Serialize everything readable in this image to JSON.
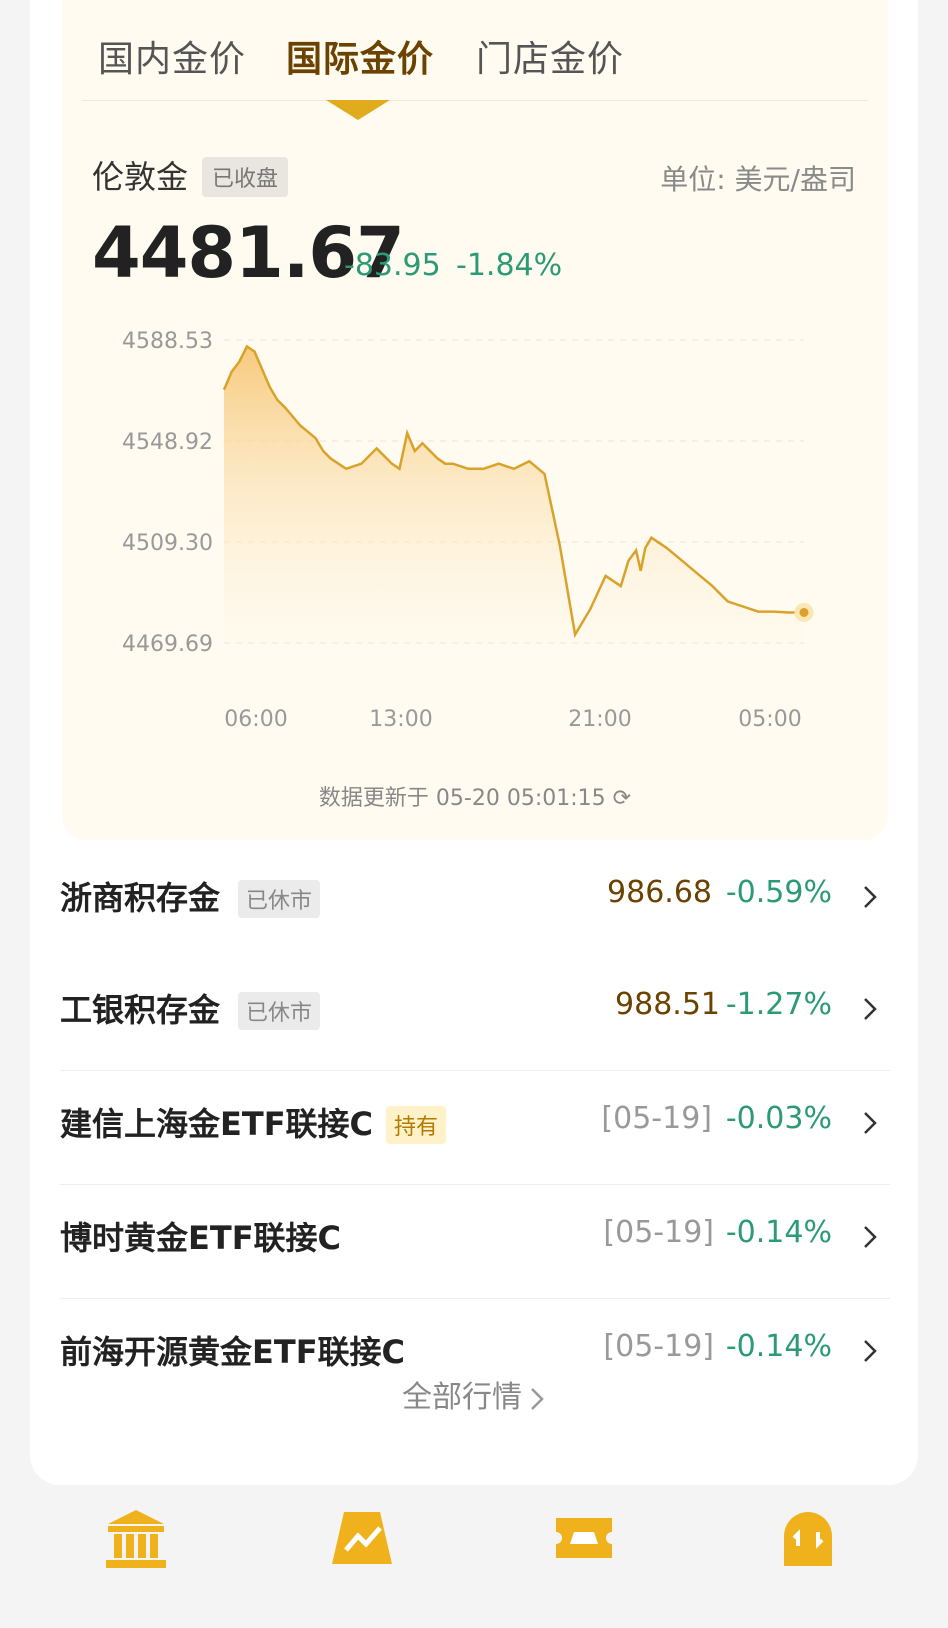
{
  "tabs": [
    {
      "label": "国内金价"
    },
    {
      "label": "国际金价"
    },
    {
      "label": "门店金价"
    }
  ],
  "active_tab": 1,
  "instrument": {
    "name": "伦敦金",
    "status": "已收盘",
    "unit": "单位: 美元/盎司",
    "price": "4481.67",
    "change": "-83.95",
    "change_pct": "-1.84%"
  },
  "chart_data": {
    "type": "area",
    "y_ticks": [
      "4588.53",
      "4548.92",
      "4509.30",
      "4469.69"
    ],
    "x_ticks": [
      "06:00",
      "13:00",
      "21:00",
      "05:00"
    ],
    "ylim": [
      4469.69,
      4588.53
    ],
    "x": [
      0,
      0.5,
      1,
      1.5,
      2,
      3,
      3.5,
      4,
      5,
      6,
      6.5,
      7,
      8,
      9,
      10,
      11,
      11.5,
      12,
      12.5,
      13,
      13.5,
      14,
      14.5,
      15,
      16,
      17,
      18,
      19,
      20,
      21,
      22,
      23,
      24,
      25,
      26,
      26.5,
      27,
      27.3,
      27.6,
      28,
      28.5,
      29,
      30,
      31,
      32,
      33,
      34,
      35,
      36,
      37,
      38
    ],
    "values": [
      4569,
      4576,
      4580,
      4586,
      4584,
      4570,
      4565,
      4562,
      4555,
      4550,
      4545,
      4542,
      4538,
      4540,
      4546,
      4540,
      4538,
      4552,
      4545,
      4548,
      4545,
      4542,
      4540,
      4540,
      4538,
      4538,
      4540,
      4538,
      4541,
      4536,
      4508,
      4473,
      4483,
      4496,
      4492,
      4502,
      4506,
      4498,
      4507,
      4511,
      4509,
      4507,
      4502,
      4497,
      4492,
      4486,
      4484,
      4482,
      4482,
      4481.67,
      4481.67
    ],
    "line_color": "#d9a22a",
    "area_color": "#f7c777"
  },
  "update_text": "数据更新于 05-20 05:01:15 ⟳",
  "products": [
    {
      "name": "浙商积存金",
      "badge": "已休市",
      "value": "986.68",
      "pct": "-0.59%"
    },
    {
      "name": "工银积存金",
      "badge": "已休市",
      "value": "988.51",
      "pct": "-1.27%"
    },
    {
      "name": "建信上海金ETF联接C",
      "badge": "持有",
      "date": "[05-19]",
      "pct": "-0.03%"
    },
    {
      "name": "博时黄金ETF联接C",
      "date": "[05-19]",
      "pct": "-0.14%"
    },
    {
      "name": "前海开源黄金ETF联接C",
      "date": "[05-19]",
      "pct": "-0.14%"
    }
  ],
  "all_label": "全部行情",
  "bottom_icons": [
    "bank-icon",
    "gold-chart-icon",
    "gold-ticket-icon",
    "gold-exchange-icon"
  ],
  "accent": "#e0ac1e"
}
